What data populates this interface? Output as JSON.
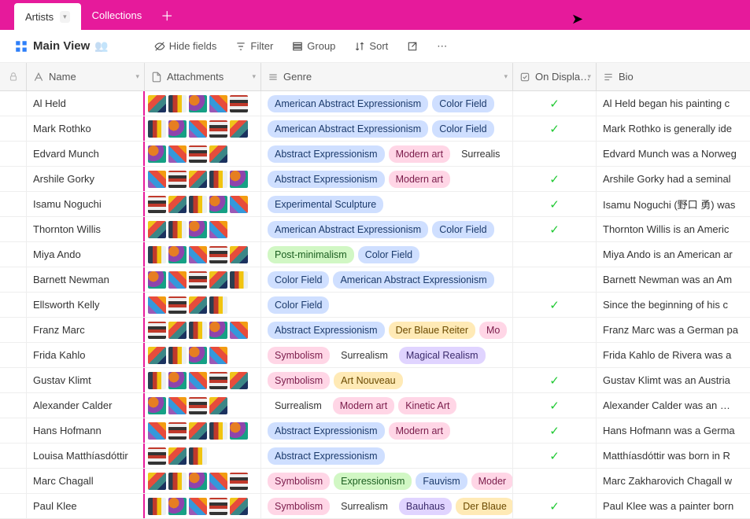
{
  "tabs": {
    "active": "Artists",
    "other": "Collections"
  },
  "view": {
    "name": "Main View"
  },
  "toolbar": {
    "hide_fields": "Hide fields",
    "filter": "Filter",
    "group": "Group",
    "sort": "Sort"
  },
  "columns": {
    "name": "Name",
    "attachments": "Attachments",
    "genre": "Genre",
    "on_display": "On Displa…",
    "bio": "Bio"
  },
  "genre_colors": {
    "American Abstract Expressionism": "blue",
    "Color Field": "blue",
    "Abstract Expressionism": "blue",
    "Modern art": "pink",
    "Surrealism": "plain",
    "Experimental Sculpture": "blue",
    "Post-minimalism": "green",
    "Der Blaue Reiter": "yellow",
    "Mo": "pink",
    "Symbolism": "pink",
    "Magical Realism": "purple",
    "Art Nouveau": "yellow",
    "Kinetic Art": "pink",
    "Expressionism": "green",
    "Fauvism": "blue",
    "Moder": "pink",
    "Bauhaus": "purple",
    "Der Blaue": "yellow",
    "Surrealis": "plain"
  },
  "rows": [
    {
      "name": "Al Held",
      "thumbs": 5,
      "genres": [
        "American Abstract Expressionism",
        "Color Field"
      ],
      "on_display": true,
      "bio": "Al Held began his painting c"
    },
    {
      "name": "Mark Rothko",
      "thumbs": 5,
      "genres": [
        "American Abstract Expressionism",
        "Color Field"
      ],
      "on_display": true,
      "bio": "Mark Rothko is generally ide"
    },
    {
      "name": "Edvard Munch",
      "thumbs": 4,
      "genres": [
        "Abstract Expressionism",
        "Modern art",
        "Surrealis"
      ],
      "on_display": false,
      "bio": "Edvard Munch was a Norweg"
    },
    {
      "name": "Arshile Gorky",
      "thumbs": 5,
      "genres": [
        "Abstract Expressionism",
        "Modern art"
      ],
      "on_display": true,
      "bio": "Arshile Gorky had a seminal"
    },
    {
      "name": "Isamu Noguchi",
      "thumbs": 5,
      "genres": [
        "Experimental Sculpture"
      ],
      "on_display": true,
      "bio": "Isamu Noguchi (野口 勇) was"
    },
    {
      "name": "Thornton Willis",
      "thumbs": 4,
      "genres": [
        "American Abstract Expressionism",
        "Color Field"
      ],
      "on_display": true,
      "bio": "Thornton Willis is an Americ"
    },
    {
      "name": "Miya Ando",
      "thumbs": 5,
      "genres": [
        "Post-minimalism",
        "Color Field"
      ],
      "on_display": false,
      "bio": "Miya Ando is an American ar"
    },
    {
      "name": "Barnett Newman",
      "thumbs": 5,
      "genres": [
        "Color Field",
        "American Abstract Expressionism"
      ],
      "on_display": false,
      "bio": "Barnett Newman was an Am"
    },
    {
      "name": "Ellsworth Kelly",
      "thumbs": 4,
      "genres": [
        "Color Field"
      ],
      "on_display": true,
      "bio": "Since the beginning of his c"
    },
    {
      "name": "Franz Marc",
      "thumbs": 5,
      "genres": [
        "Abstract Expressionism",
        "Der Blaue Reiter",
        "Mo"
      ],
      "on_display": false,
      "bio": "Franz Marc was a German pa"
    },
    {
      "name": "Frida Kahlo",
      "thumbs": 4,
      "genres": [
        "Symbolism",
        "Surrealism",
        "Magical Realism"
      ],
      "on_display": false,
      "bio": "Frida Kahlo de Rivera was a"
    },
    {
      "name": "Gustav Klimt",
      "thumbs": 5,
      "genres": [
        "Symbolism",
        "Art Nouveau"
      ],
      "on_display": true,
      "bio": "Gustav Klimt was an Austria"
    },
    {
      "name": "Alexander Calder",
      "thumbs": 4,
      "genres": [
        "Surrealism",
        "Modern art",
        "Kinetic Art"
      ],
      "on_display": true,
      "bio": "Alexander Calder was an …"
    },
    {
      "name": "Hans Hofmann",
      "thumbs": 5,
      "genres": [
        "Abstract Expressionism",
        "Modern art"
      ],
      "on_display": true,
      "bio": "Hans Hofmann was a Germa"
    },
    {
      "name": "Louisa Matthíasdóttir",
      "thumbs": 3,
      "genres": [
        "Abstract Expressionism"
      ],
      "on_display": true,
      "bio": "Matthíasdóttir was born in R"
    },
    {
      "name": "Marc Chagall",
      "thumbs": 5,
      "genres": [
        "Symbolism",
        "Expressionism",
        "Fauvism",
        "Moder"
      ],
      "on_display": false,
      "bio": "Marc Zakharovich Chagall w"
    },
    {
      "name": "Paul Klee",
      "thumbs": 5,
      "genres": [
        "Symbolism",
        "Surrealism",
        "Bauhaus",
        "Der Blaue"
      ],
      "on_display": true,
      "bio": "Paul Klee was a painter born"
    }
  ]
}
